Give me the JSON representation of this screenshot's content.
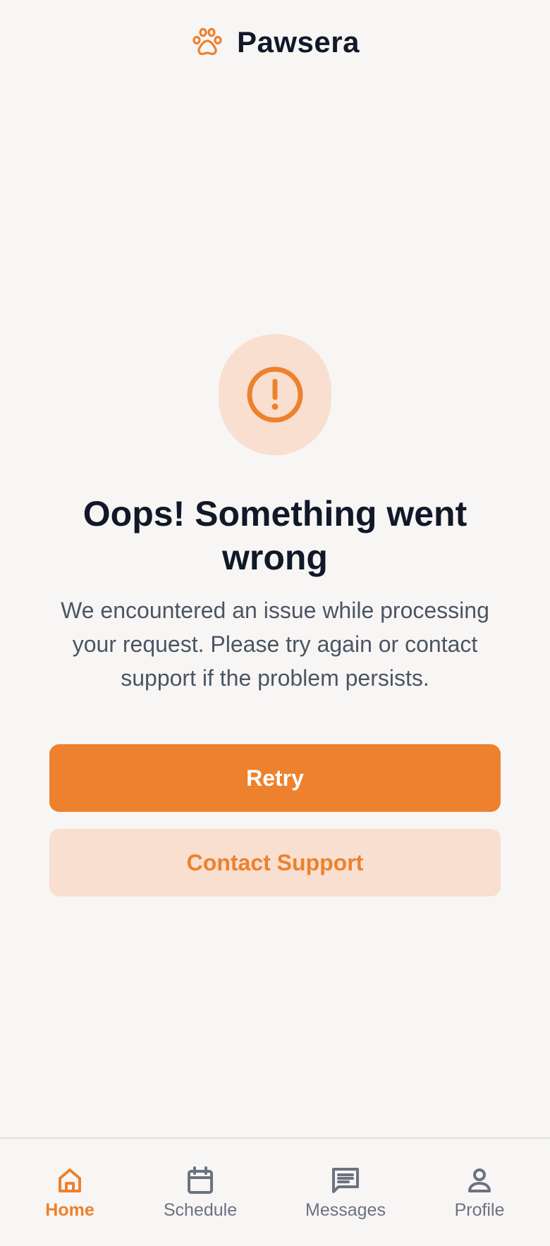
{
  "app": {
    "brand_name": "Pawsera",
    "brand_icon": "paw-icon",
    "accent_color": "#ed812d",
    "accent_soft_color": "#f8dfd0"
  },
  "error": {
    "icon": "alert-circle-icon",
    "title": "Oops! Something went wrong",
    "description": "We encountered an issue while processing your request. Please try again or contact support if the problem persists.",
    "primary_action": "Retry",
    "secondary_action": "Contact Support"
  },
  "bottom_nav": {
    "items": [
      {
        "label": "Home",
        "icon": "home-icon",
        "active": true
      },
      {
        "label": "Schedule",
        "icon": "calendar-icon",
        "active": false
      },
      {
        "label": "Messages",
        "icon": "message-icon",
        "active": false
      },
      {
        "label": "Profile",
        "icon": "user-icon",
        "active": false
      }
    ]
  }
}
